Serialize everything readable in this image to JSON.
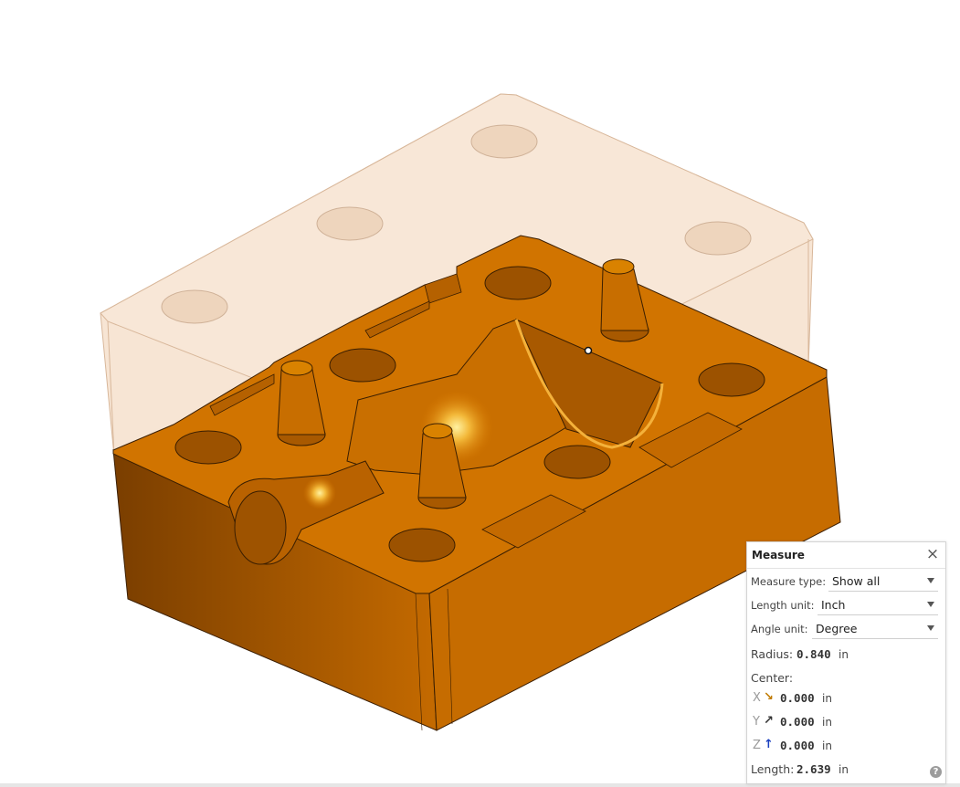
{
  "colors": {
    "part_face": "#cf7000",
    "part_side": "#8a4700",
    "part_top_glow": "#f0b030",
    "transparent_block": "#f5dcc6",
    "selection_edge": "#f4b13a"
  },
  "measure_panel": {
    "title": "Measure",
    "close_icon": "×",
    "measure_type_label": "Measure type:",
    "measure_type_value": "Show all",
    "length_unit_label": "Length unit:",
    "length_unit_value": "Inch",
    "angle_unit_label": "Angle unit:",
    "angle_unit_value": "Degree",
    "radius_label": "Radius:",
    "radius_value": "0.840",
    "radius_unit": "in",
    "center_label": "Center:",
    "center_x_axis": "X",
    "center_x_value": "0.000",
    "center_x_unit": "in",
    "center_y_axis": "Y",
    "center_y_value": "0.000",
    "center_y_unit": "in",
    "center_z_axis": "Z",
    "center_z_value": "0.000",
    "center_z_unit": "in",
    "length_label": "Length:",
    "length_value": "2.639",
    "length_unit": "in",
    "help_icon": "?"
  }
}
